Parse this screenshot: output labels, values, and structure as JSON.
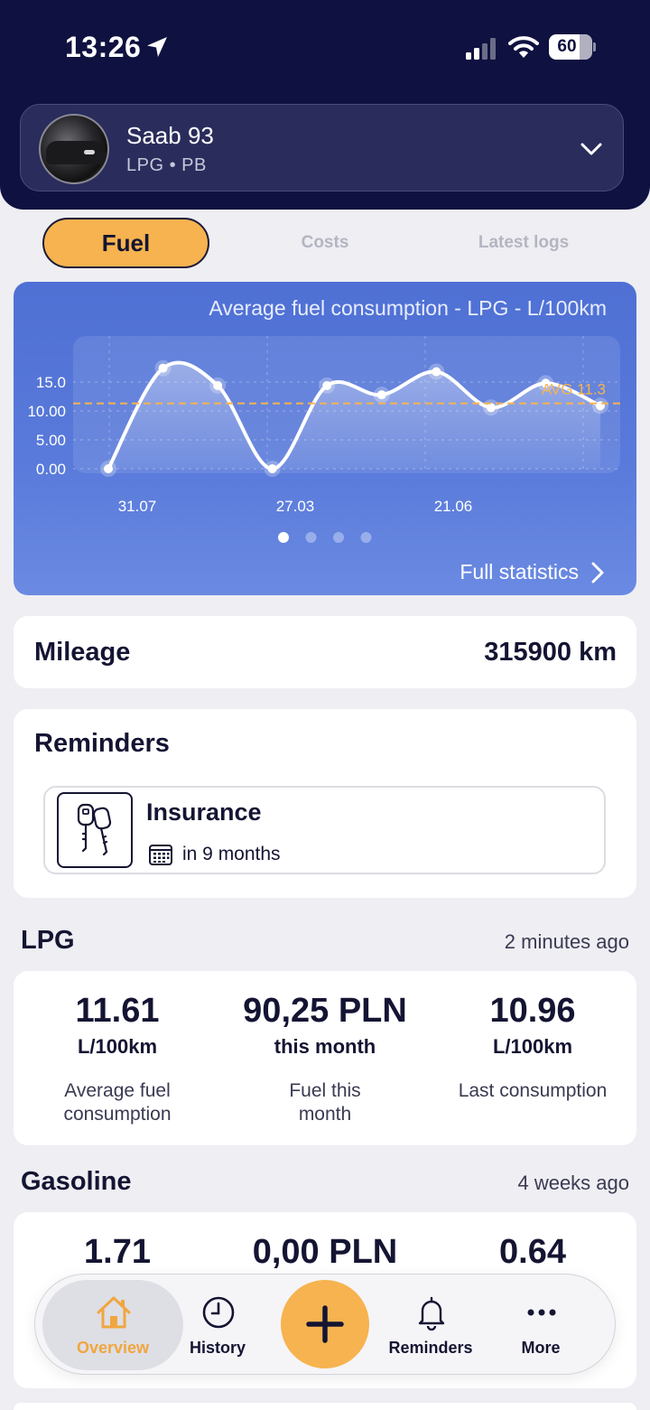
{
  "status_bar": {
    "time": "13:26",
    "battery": "60"
  },
  "vehicle": {
    "name": "Saab 93",
    "fuels": "LPG • PB"
  },
  "tabs": {
    "fuel": "Fuel",
    "costs": "Costs",
    "latest_logs": "Latest logs"
  },
  "chart_data": {
    "type": "line",
    "title": "Average fuel consumption - LPG - L/100km",
    "xlabel": "",
    "ylabel": "",
    "x_tick_labels": [
      "31.07",
      "27.03",
      "21.06"
    ],
    "y_tick_labels": [
      "0.00",
      "5.00",
      "10.00",
      "15.0"
    ],
    "y_ticks": [
      0,
      5,
      10,
      15
    ],
    "ylim": [
      0,
      20
    ],
    "series": [
      {
        "values": [
          0,
          17.4,
          14.4,
          0,
          14.4,
          12.8,
          16.8,
          10.6,
          14.8,
          10.9
        ]
      }
    ],
    "average": {
      "label": "AVG 11.3",
      "value": 11.3
    },
    "grid": true,
    "page_indicator": {
      "pages": 4,
      "active": 0
    }
  },
  "chart_card": {
    "full_statistics": "Full statistics"
  },
  "mileage": {
    "label": "Mileage",
    "value": "315900 km"
  },
  "reminders": {
    "title": "Reminders",
    "items": [
      {
        "name": "Insurance",
        "due": "in 9 months"
      }
    ]
  },
  "lpg": {
    "title": "LPG",
    "updated": "2 minutes ago",
    "stats": [
      {
        "value": "11.61",
        "unit": "L/100km",
        "label": "Average fuel consumption"
      },
      {
        "value": "90,25 PLN",
        "unit": "this month",
        "label": "Fuel this month"
      },
      {
        "value": "10.96",
        "unit": "L/100km",
        "label": "Last consumption"
      }
    ]
  },
  "gasoline": {
    "title": "Gasoline",
    "updated": "4 weeks ago",
    "stats": [
      {
        "value": "1.71"
      },
      {
        "value": "0,00 PLN"
      },
      {
        "value": "0.64"
      }
    ]
  },
  "tab_bar": {
    "overview": "Overview",
    "history": "History",
    "reminders": "Reminders",
    "more": "More"
  },
  "colors": {
    "accent": "#f6b34f",
    "navy": "#0f1140",
    "chart_blue": "#5474d6"
  }
}
